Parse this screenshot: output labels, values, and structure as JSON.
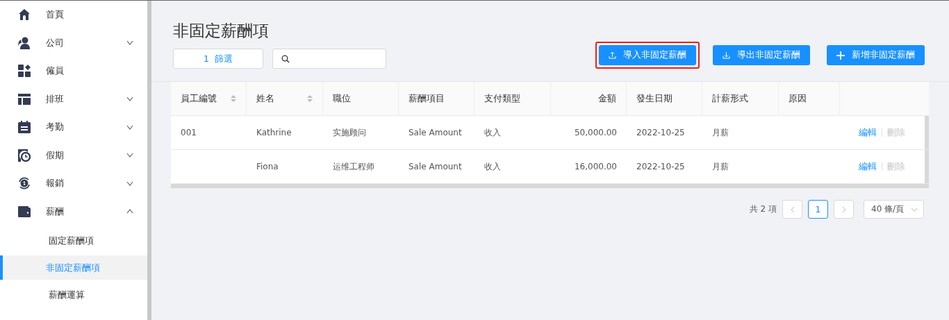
{
  "sidebar": {
    "items": [
      {
        "label": "首頁",
        "kind": "link"
      },
      {
        "label": "公司",
        "kind": "group",
        "expanded": false
      },
      {
        "label": "僱員",
        "kind": "link"
      },
      {
        "label": "排班",
        "kind": "group",
        "expanded": false
      },
      {
        "label": "考勤",
        "kind": "group",
        "expanded": false
      },
      {
        "label": "假期",
        "kind": "group",
        "expanded": false
      },
      {
        "label": "報銷",
        "kind": "group",
        "expanded": false
      },
      {
        "label": "薪酬",
        "kind": "group",
        "expanded": true,
        "children": [
          {
            "label": "固定薪酬項",
            "selected": false
          },
          {
            "label": "非固定薪酬項",
            "selected": true
          },
          {
            "label": "薪酬運算",
            "selected": false
          }
        ]
      }
    ]
  },
  "page": {
    "title": "非固定薪酬項",
    "filter_button": {
      "count": "1",
      "label": "篩選"
    },
    "buttons": [
      {
        "label": "導入非固定薪酬",
        "kind": "upload",
        "highlighted": true
      },
      {
        "label": "導出非固定薪酬",
        "kind": "download",
        "highlighted": false
      },
      {
        "label": "新增非固定薪酬",
        "kind": "add",
        "highlighted": false
      }
    ]
  },
  "table": {
    "columns": [
      {
        "label": "員工編號",
        "sortable": true
      },
      {
        "label": "姓名",
        "sortable": true
      },
      {
        "label": "職位",
        "sortable": false
      },
      {
        "label": "薪酬項目",
        "sortable": false
      },
      {
        "label": "支付類型",
        "sortable": false
      },
      {
        "label": "金額",
        "sortable": false
      },
      {
        "label": "發生日期",
        "sortable": false
      },
      {
        "label": "計薪形式",
        "sortable": false
      },
      {
        "label": "原因",
        "sortable": false
      }
    ],
    "rows": [
      {
        "cells": [
          "001",
          "Kathrine",
          "实施顾问",
          "Sale Amount",
          "收入",
          "50,000.00",
          "2022-10-25",
          "月薪",
          ""
        ],
        "actions": [
          {
            "label": "編輯",
            "disabled": false
          },
          {
            "label": "刪除",
            "disabled": true
          }
        ]
      },
      {
        "cells": [
          "",
          "Fiona",
          "运维工程师",
          "Sale Amount",
          "收入",
          "16,000.00",
          "2022-10-25",
          "月薪",
          ""
        ],
        "actions": [
          {
            "label": "編輯",
            "disabled": false
          },
          {
            "label": "刪除",
            "disabled": true
          }
        ]
      }
    ]
  },
  "pagination": {
    "total": "共 2 項",
    "pages": [
      {
        "label": "1",
        "selected": true
      }
    ],
    "page_size": "40 條/頁"
  }
}
